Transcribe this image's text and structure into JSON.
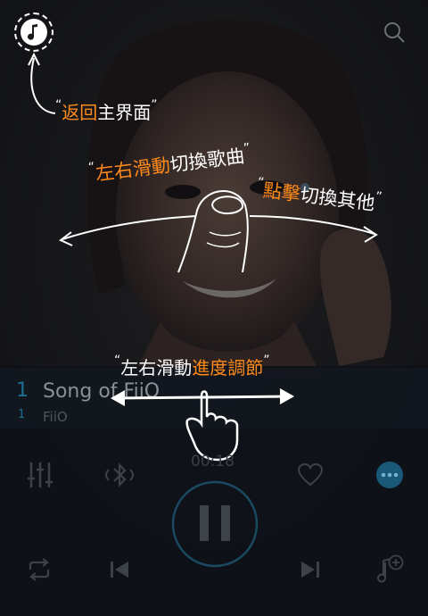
{
  "overlay": {
    "back_home": {
      "q_open": "“",
      "hl": "返回",
      "rest": "主界面",
      "q_close": "”"
    },
    "swipe_song": {
      "q_open": "“",
      "hl": "左右滑動",
      "rest": "切換歌曲",
      "q_close": "”"
    },
    "tap_switch": {
      "q_open": "“",
      "hl": "點擊",
      "rest": "切換其他",
      "q_close": "”"
    },
    "seek": {
      "q_open": "“",
      "rest": "左右滑動",
      "hl": "進度調節",
      "q_close": "”"
    }
  },
  "track": {
    "index_main": "1",
    "index_sub": "1",
    "title": "Song of FiiO",
    "artist": "FiiO"
  },
  "time": "00:18",
  "icons": {
    "top_left": "music-note-icon",
    "top_right": "search-icon",
    "eq": "equalizer-icon",
    "bt": "bluetooth-icon",
    "fav": "heart-icon",
    "more": "more-icon",
    "play": "pause-icon",
    "repeat": "repeat-icon",
    "prev": "previous-icon",
    "next": "next-icon",
    "add": "add-to-playlist-icon"
  },
  "colors": {
    "accent": "#ff8a1a",
    "teal": "#1d6f93",
    "more_btn": "#1a5877"
  }
}
